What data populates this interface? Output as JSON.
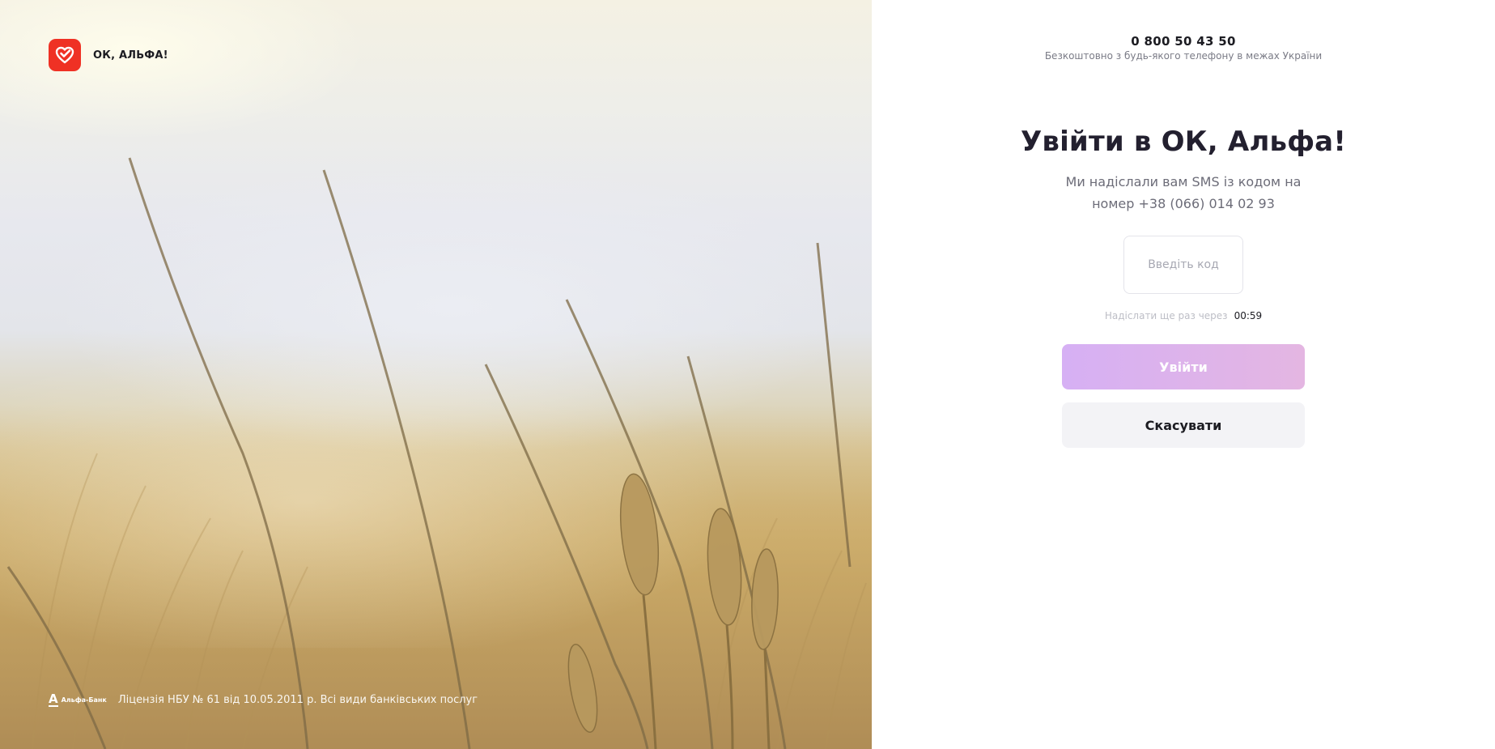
{
  "brand": {
    "name": "ОК, АЛЬФА!",
    "logo_icon": "checkmark-heart-icon",
    "accent": "#ef3124"
  },
  "header": {
    "phone": "0 800 50 43 50",
    "phone_note": "Безкоштовно з будь-якого телефону в межах України"
  },
  "login": {
    "title": "Увійти в ОК, Альфа!",
    "subtitle": "Ми надіслали вам SMS із кодом на номер +38 (066) 014 02 93",
    "code_input": {
      "value": "",
      "placeholder": "Введіть код"
    },
    "resend_label": "Надіслати ще раз через",
    "resend_timer": "00:59",
    "submit_label": "Увійти",
    "cancel_label": "Скасувати"
  },
  "footer": {
    "bank_logo_letter": "А",
    "bank_logo_name": "Альфа-Банк",
    "license": "Ліцензія НБУ № 61 від 10.05.2011 р. Всі види банківських послуг"
  },
  "colors": {
    "submit_gradient_start": "#d6b0f4",
    "submit_gradient_end": "#e4b6e2",
    "cancel_bg": "#f3f3f6",
    "title_text": "#23202f"
  }
}
